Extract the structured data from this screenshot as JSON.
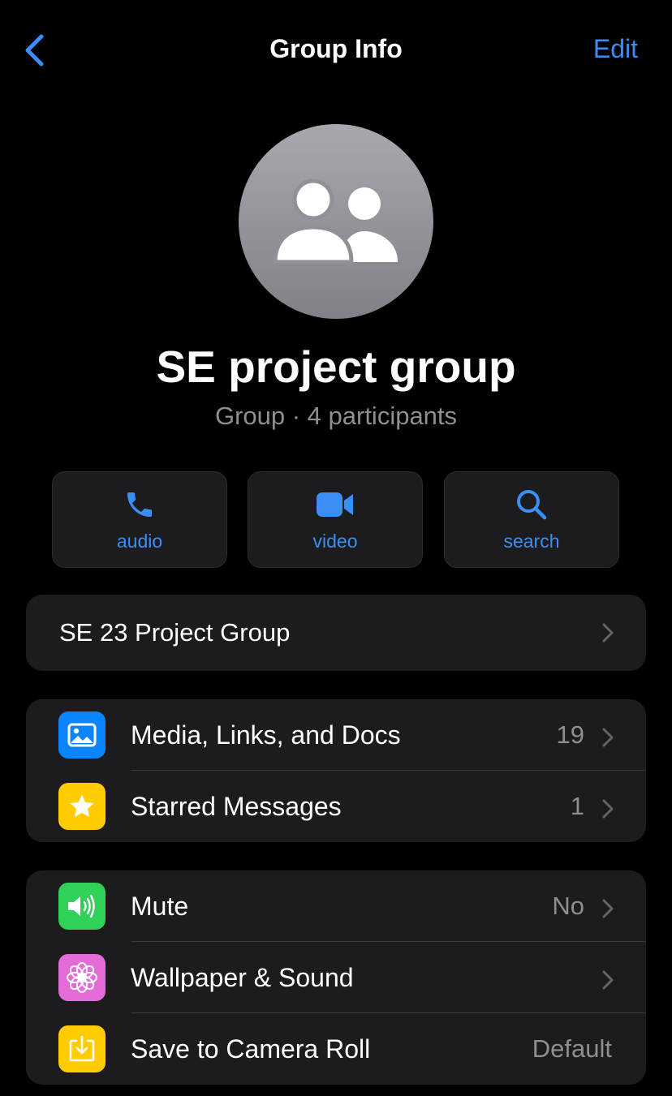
{
  "nav": {
    "title": "Group Info",
    "edit_label": "Edit"
  },
  "group": {
    "name": "SE project group",
    "subtitle": "Group · 4 participants"
  },
  "actions": [
    {
      "label": "audio",
      "icon": "phone-icon"
    },
    {
      "label": "video",
      "icon": "video-camera-icon"
    },
    {
      "label": "search",
      "icon": "search-icon"
    }
  ],
  "description": {
    "text": "SE 23 Project Group"
  },
  "media_section": [
    {
      "label": "Media, Links, and Docs",
      "value": "19",
      "icon": "photo-icon",
      "icon_color": "#0a84ff"
    },
    {
      "label": "Starred Messages",
      "value": "1",
      "icon": "star-icon",
      "icon_color": "#ffcc00"
    }
  ],
  "settings_section": [
    {
      "label": "Mute",
      "value": "No",
      "icon": "speaker-icon",
      "icon_color": "#30d158"
    },
    {
      "label": "Wallpaper & Sound",
      "value": "",
      "icon": "flower-icon",
      "icon_color": "#e56bd8"
    },
    {
      "label": "Save to Camera Roll",
      "value": "Default",
      "icon": "download-icon",
      "icon_color": "#ffcc00"
    }
  ],
  "colors": {
    "accent": "#3a8ef6",
    "background": "#000000",
    "card": "#1c1c1e",
    "secondary_text": "#8e8e93"
  }
}
